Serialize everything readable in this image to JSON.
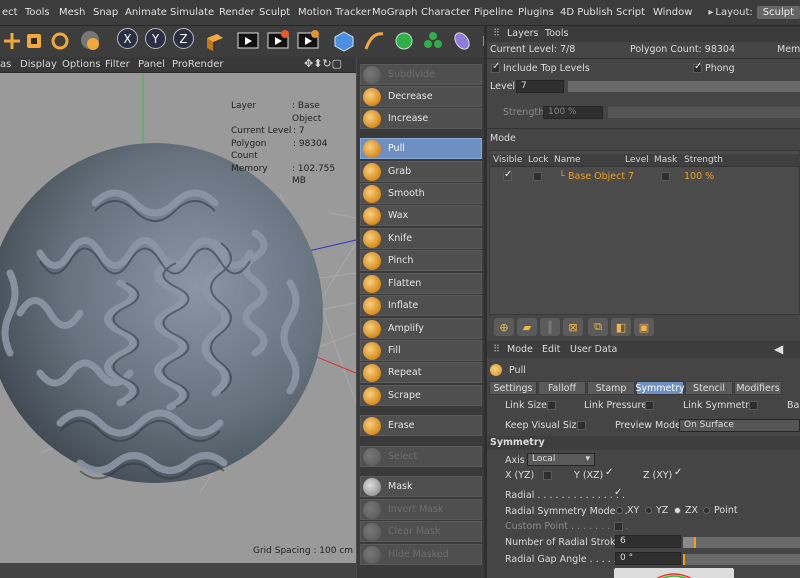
{
  "menubar": {
    "items": [
      "ect",
      "Tools",
      "Mesh",
      "Snap",
      "Animate",
      "Simulate",
      "Render",
      "Sculpt",
      "Motion Tracker",
      "MoGraph",
      "Character",
      "Pipeline",
      "Plugins",
      "4D Publish",
      "Script",
      "Window"
    ],
    "layout_label": "Layout:",
    "layout_value": "Sculpt"
  },
  "viewport_menu": {
    "items": [
      "as",
      "Display",
      "Options",
      "Filter",
      "Panel",
      "ProRender"
    ]
  },
  "hud": {
    "rows": [
      {
        "k": "Layer",
        "v": ": Base Object"
      },
      {
        "k": "Current Level",
        "v": ": 7"
      },
      {
        "k": "Polygon Count",
        "v": ": 98304"
      },
      {
        "k": "Memory",
        "v": ": 102.755 MB"
      }
    ],
    "grid_spacing": "Grid Spacing : 100 cm"
  },
  "brushes": [
    {
      "label": "Subdivide",
      "state": "dim"
    },
    {
      "label": "Decrease",
      "state": "normal"
    },
    {
      "label": "Increase",
      "state": "normal"
    },
    {
      "label": "Pull",
      "state": "selected"
    },
    {
      "label": "Grab",
      "state": "normal"
    },
    {
      "label": "Smooth",
      "state": "normal"
    },
    {
      "label": "Wax",
      "state": "normal"
    },
    {
      "label": "Knife",
      "state": "normal"
    },
    {
      "label": "Pinch",
      "state": "normal"
    },
    {
      "label": "Flatten",
      "state": "normal"
    },
    {
      "label": "Inflate",
      "state": "normal"
    },
    {
      "label": "Amplify",
      "state": "normal"
    },
    {
      "label": "Fill",
      "state": "normal"
    },
    {
      "label": "Repeat",
      "state": "normal"
    },
    {
      "label": "Scrape",
      "state": "normal"
    },
    {
      "label": "Erase",
      "state": "normal"
    },
    {
      "label": "Select",
      "state": "dim"
    },
    {
      "label": "Mask",
      "state": "normal"
    },
    {
      "label": "Invert Mask",
      "state": "dim"
    },
    {
      "label": "Clear Mask",
      "state": "dim"
    },
    {
      "label": "Hide Masked",
      "state": "dim"
    }
  ],
  "layers_panel": {
    "tabs": [
      "Layers",
      "Tools"
    ],
    "current_level": "Current Level: 7/8",
    "polygon_count": "Polygon Count: 98304",
    "memory_label": "Memo",
    "include_top_levels": "Include Top Levels",
    "phong": "Phong",
    "level_label": "Level",
    "level_value": "7",
    "strength_label": "Strength",
    "strength_value": "100 %",
    "mode_label": "Mode",
    "columns": [
      "Visible",
      "Lock",
      "Name",
      "Level",
      "Mask",
      "Strength"
    ],
    "rows": [
      {
        "name": "Base Object",
        "level": "7",
        "strength": "100 %"
      }
    ]
  },
  "attributes": {
    "menu": [
      "Mode",
      "Edit",
      "User Data"
    ],
    "tool_name": "Pull",
    "tabs": [
      "Settings",
      "Falloff",
      "Stamp",
      "Symmetry",
      "Stencil",
      "Modifiers"
    ],
    "active_tab": "Symmetry",
    "link_size": "Link Size",
    "link_pressure": "Link Pressure",
    "link_symmetry": "Link Symmetry",
    "link_truncated": "Bac",
    "keep_visual_size": "Keep Visual Size",
    "preview_mode_label": "Preview Mode",
    "preview_mode_value": "On Surface",
    "section": "Symmetry",
    "axis_label": "Axis",
    "axis_value": "Local",
    "x_yz": "X (YZ)",
    "y_xz": "Y (XZ)",
    "z_xy": "Z (XY)",
    "radial": "Radial . . . . . . . . . . . . . . .",
    "radial_mode": "Radial Symmetry Mode . .",
    "radial_options": [
      "XY",
      "YZ",
      "ZX",
      "Point"
    ],
    "custom_point": "Custom Point . . . . . . . . . .",
    "num_strokes_label": "Number of Radial Strokes",
    "num_strokes_value": "6",
    "gap_label": "Radial Gap Angle . . . . . .",
    "gap_value": "0 °"
  },
  "colors": {
    "accent": "#6e8fc1",
    "orange": "#f0a020",
    "viewport": "#9a9a9a"
  }
}
